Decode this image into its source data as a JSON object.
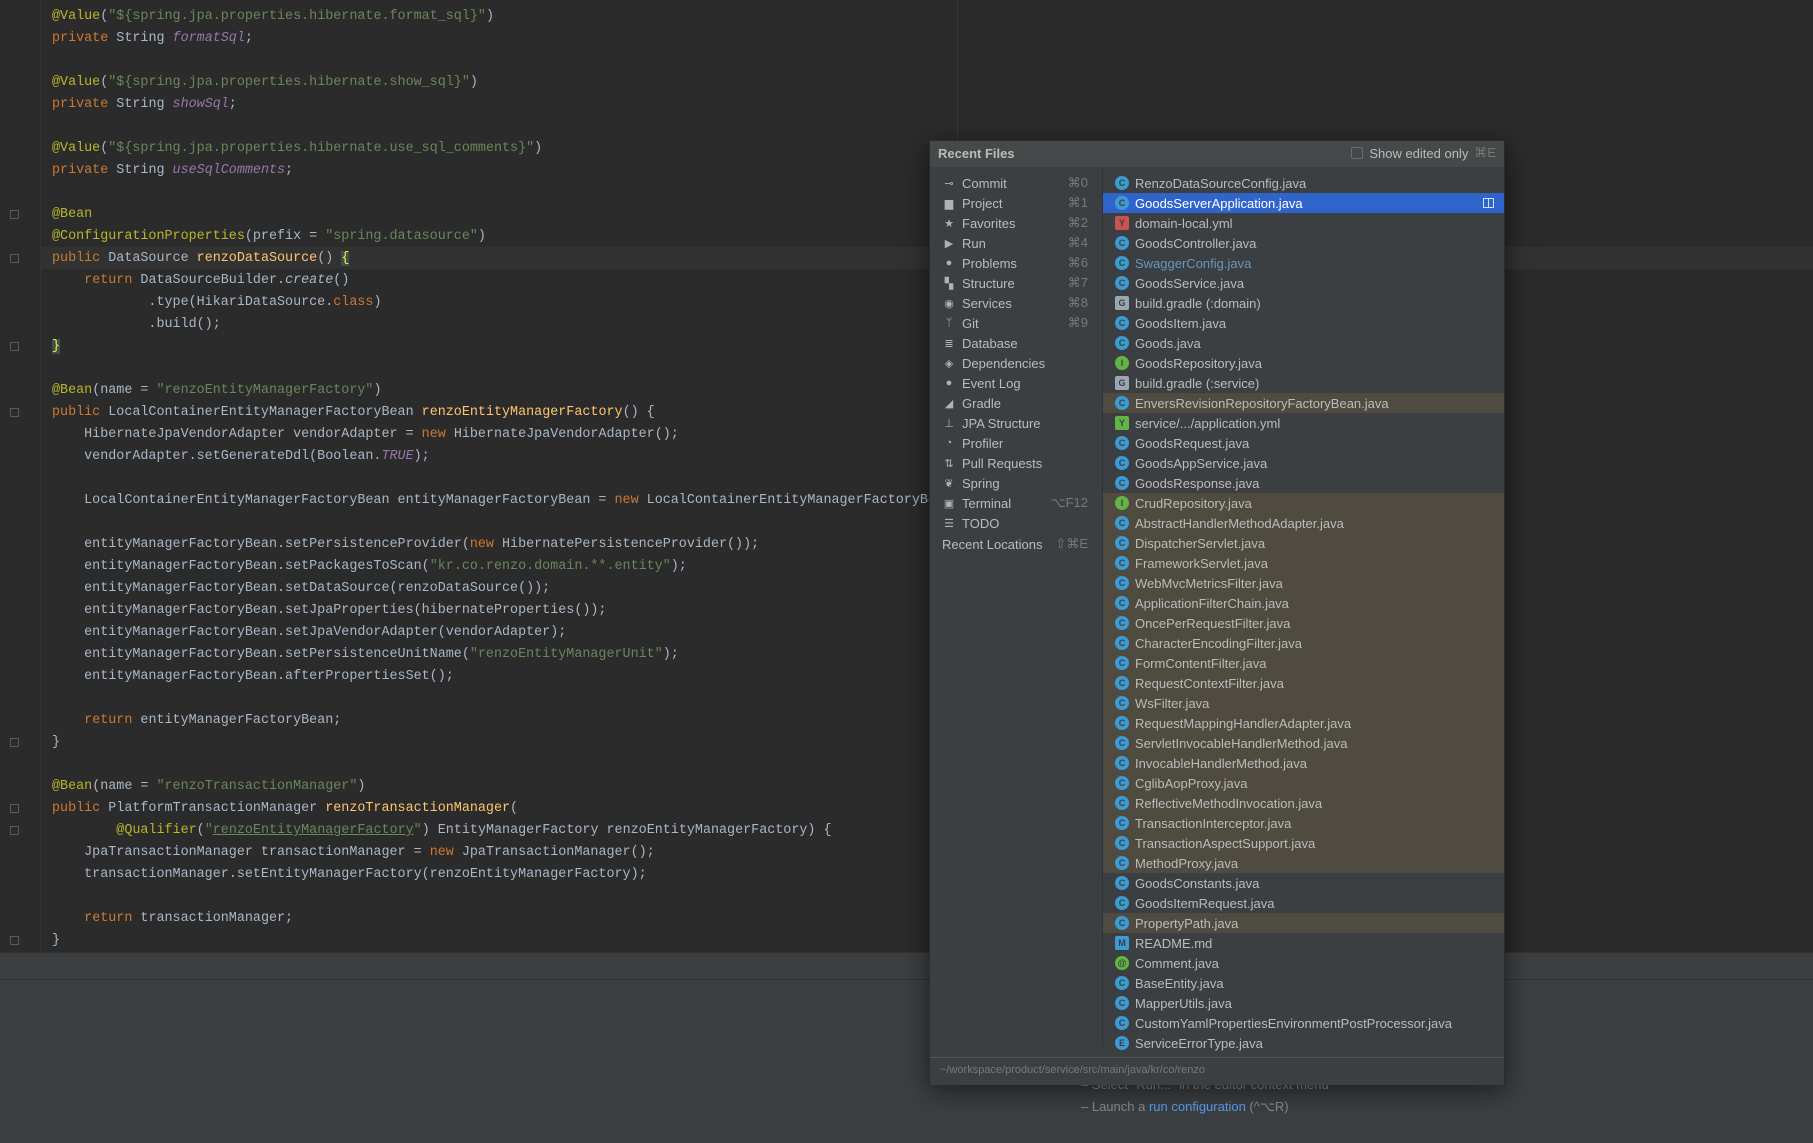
{
  "editor": {
    "lines": [
      [
        [
          "an",
          "@Value"
        ],
        [
          "",
          "("
        ],
        [
          "st",
          "\"${spring.jpa.properties.hibernate.format_sql}\""
        ],
        [
          "",
          ")"
        ]
      ],
      [
        [
          "kw",
          "private "
        ],
        [
          "",
          "String "
        ],
        [
          "cn",
          "formatSql"
        ],
        [
          "",
          ";"
        ]
      ],
      [],
      [
        [
          "an",
          "@Value"
        ],
        [
          "",
          "("
        ],
        [
          "st",
          "\"${spring.jpa.properties.hibernate.show_sql}\""
        ],
        [
          "",
          ")"
        ]
      ],
      [
        [
          "kw",
          "private "
        ],
        [
          "",
          "String "
        ],
        [
          "cn",
          "showSql"
        ],
        [
          "",
          ";"
        ]
      ],
      [],
      [
        [
          "an",
          "@Value"
        ],
        [
          "",
          "("
        ],
        [
          "st",
          "\"${spring.jpa.properties.hibernate.use_sql_comments}\""
        ],
        [
          "",
          ")"
        ]
      ],
      [
        [
          "kw",
          "private "
        ],
        [
          "",
          "String "
        ],
        [
          "cn",
          "useSqlComments"
        ],
        [
          "",
          ";"
        ]
      ],
      [],
      [
        [
          "an",
          "@Bean"
        ]
      ],
      [
        [
          "an",
          "@ConfigurationProperties"
        ],
        [
          "",
          "(prefix = "
        ],
        [
          "st",
          "\"spring.datasource\""
        ],
        [
          "",
          ")"
        ]
      ],
      [
        [
          "kw",
          "public "
        ],
        [
          "",
          "DataSource "
        ],
        [
          "fn",
          "renzoDataSource"
        ],
        [
          "",
          "() "
        ],
        [
          "brace",
          "{"
        ]
      ],
      [
        [
          "",
          "    "
        ],
        [
          "kw",
          "return "
        ],
        [
          "",
          "DataSourceBuilder."
        ],
        [
          "it",
          "create"
        ],
        [
          "",
          "()"
        ]
      ],
      [
        [
          "",
          "            .type(HikariDataSource."
        ],
        [
          "kw",
          "class"
        ],
        [
          "",
          ")"
        ]
      ],
      [
        [
          "",
          "            .build();"
        ]
      ],
      [
        [
          "brace",
          "}"
        ]
      ],
      [],
      [
        [
          "an",
          "@Bean"
        ],
        [
          "",
          "(name = "
        ],
        [
          "st",
          "\"renzoEntityManagerFactory\""
        ],
        [
          "",
          ")"
        ]
      ],
      [
        [
          "kw",
          "public "
        ],
        [
          "",
          "LocalContainerEntityManagerFactoryBean "
        ],
        [
          "fn",
          "renzoEntityManagerFactory"
        ],
        [
          "",
          "() {"
        ]
      ],
      [
        [
          "",
          "    HibernateJpaVendorAdapter vendorAdapter = "
        ],
        [
          "kw",
          "new "
        ],
        [
          "",
          "HibernateJpaVendorAdapter();"
        ]
      ],
      [
        [
          "",
          "    vendorAdapter.setGenerateDdl(Boolean."
        ],
        [
          "cn",
          "TRUE"
        ],
        [
          "",
          ");"
        ]
      ],
      [],
      [
        [
          "",
          "    LocalContainerEntityManagerFactoryBean entityManagerFactoryBean = "
        ],
        [
          "kw",
          "new "
        ],
        [
          "",
          "LocalContainerEntityManagerFactoryBean();"
        ]
      ],
      [],
      [
        [
          "",
          "    entityManagerFactoryBean.setPersistenceProvider("
        ],
        [
          "kw",
          "new "
        ],
        [
          "",
          "HibernatePersistenceProvider());"
        ]
      ],
      [
        [
          "",
          "    entityManagerFactoryBean.setPackagesToScan("
        ],
        [
          "st",
          "\"kr.co.renzo.domain.**.entity\""
        ],
        [
          "",
          ");"
        ]
      ],
      [
        [
          "",
          "    entityManagerFactoryBean.setDataSource(renzoDataSource());"
        ]
      ],
      [
        [
          "",
          "    entityManagerFactoryBean.setJpaProperties(hibernateProperties());"
        ]
      ],
      [
        [
          "",
          "    entityManagerFactoryBean.setJpaVendorAdapter(vendorAdapter);"
        ]
      ],
      [
        [
          "",
          "    entityManagerFactoryBean.setPersistenceUnitName("
        ],
        [
          "st",
          "\"renzoEntityManagerUnit\""
        ],
        [
          "",
          ");"
        ]
      ],
      [
        [
          "",
          "    entityManagerFactoryBean.afterPropertiesSet();"
        ]
      ],
      [],
      [
        [
          "",
          "    "
        ],
        [
          "kw",
          "return "
        ],
        [
          "",
          "entityManagerFactoryBean;"
        ]
      ],
      [
        [
          "",
          "}"
        ]
      ],
      [],
      [
        [
          "an",
          "@Bean"
        ],
        [
          "",
          "(name = "
        ],
        [
          "st",
          "\"renzoTransactionManager\""
        ],
        [
          "",
          ")"
        ]
      ],
      [
        [
          "kw",
          "public "
        ],
        [
          "",
          "PlatformTransactionManager "
        ],
        [
          "fn",
          "renzoTransactionManager"
        ],
        [
          "",
          "("
        ]
      ],
      [
        [
          "",
          "        "
        ],
        [
          "an",
          "@Qualifier"
        ],
        [
          "",
          "("
        ],
        [
          "st",
          "\""
        ],
        [
          "st ul",
          "renzoEntityManagerFactory"
        ],
        [
          "st",
          "\""
        ],
        [
          "",
          ") EntityManagerFactory renzoEntityManagerFactory) {"
        ]
      ],
      [
        [
          "",
          "    JpaTransactionManager transactionManager = "
        ],
        [
          "kw",
          "new "
        ],
        [
          "",
          "JpaTransactionManager();"
        ]
      ],
      [
        [
          "",
          "    transactionManager.setEntityManagerFactory(renzoEntityManagerFactory);"
        ]
      ],
      [],
      [
        [
          "",
          "    "
        ],
        [
          "kw",
          "return "
        ],
        [
          "",
          "transactionManager;"
        ]
      ],
      [
        [
          "",
          "}"
        ]
      ]
    ]
  },
  "hints": {
    "line1": "– Select \"Run...\" in the editor context menu",
    "line2_prefix": "– Launch a ",
    "line2_link": "run configuration",
    "line2_suffix": " (^⌥R)"
  },
  "popup": {
    "title": "Recent Files",
    "show_edited_label": "Show edited only",
    "show_edited_shortcut": "⌘E",
    "path": "~/workspace/product/service/src/main/java/kr/co/renzo",
    "tool_windows": [
      {
        "label": "Commit",
        "shortcut": "⌘0",
        "icon": "commit-icon",
        "glyph": "⊸"
      },
      {
        "label": "Project",
        "shortcut": "⌘1",
        "icon": "folder-icon",
        "glyph": "▆"
      },
      {
        "label": "Favorites",
        "shortcut": "⌘2",
        "icon": "star-icon",
        "glyph": "★"
      },
      {
        "label": "Run",
        "shortcut": "⌘4",
        "icon": "play-icon",
        "glyph": "▶"
      },
      {
        "label": "Problems",
        "shortcut": "⌘6",
        "icon": "warning-icon",
        "glyph": "●"
      },
      {
        "label": "Structure",
        "shortcut": "⌘7",
        "icon": "structure-icon",
        "glyph": "▚"
      },
      {
        "label": "Services",
        "shortcut": "⌘8",
        "icon": "services-icon",
        "glyph": "◉"
      },
      {
        "label": "Git",
        "shortcut": "⌘9",
        "icon": "git-branch-icon",
        "glyph": "ᛘ"
      },
      {
        "label": "Database",
        "shortcut": "",
        "icon": "database-icon",
        "glyph": "≣"
      },
      {
        "label": "Dependencies",
        "shortcut": "",
        "icon": "layers-icon",
        "glyph": "◈"
      },
      {
        "label": "Event Log",
        "shortcut": "",
        "icon": "event-log-icon",
        "glyph": "●"
      },
      {
        "label": "Gradle",
        "shortcut": "",
        "icon": "gradle-icon",
        "glyph": "◢"
      },
      {
        "label": "JPA Structure",
        "shortcut": "",
        "icon": "jpa-structure-icon",
        "glyph": "⊥"
      },
      {
        "label": "Profiler",
        "shortcut": "",
        "icon": "profiler-icon",
        "glyph": "◔"
      },
      {
        "label": "Pull Requests",
        "shortcut": "",
        "icon": "pull-request-icon",
        "glyph": "⇅"
      },
      {
        "label": "Spring",
        "shortcut": "",
        "icon": "spring-leaf-icon",
        "glyph": "❦"
      },
      {
        "label": "Terminal",
        "shortcut": "⌥F12",
        "icon": "terminal-icon",
        "glyph": "▣"
      },
      {
        "label": "TODO",
        "shortcut": "",
        "icon": "todo-list-icon",
        "glyph": "☰"
      }
    ],
    "recent_locations": {
      "label": "Recent Locations",
      "shortcut": "⇧⌘E"
    },
    "files": [
      {
        "name": "RenzoDataSourceConfig.java",
        "icon": "java-class-icon",
        "kind": "c",
        "lib": false
      },
      {
        "name": "GoodsServerApplication.java",
        "icon": "spring-boot-class-icon",
        "kind": "c",
        "lib": false,
        "selected": true
      },
      {
        "name": "domain-local.yml",
        "icon": "yaml-file-icon",
        "kind": "yml",
        "lib": false
      },
      {
        "name": "GoodsController.java",
        "icon": "java-class-icon",
        "kind": "c",
        "lib": false
      },
      {
        "name": "SwaggerConfig.java",
        "icon": "java-class-icon",
        "kind": "c",
        "lib": false,
        "modified": true
      },
      {
        "name": "GoodsService.java",
        "icon": "java-class-icon",
        "kind": "c",
        "lib": false
      },
      {
        "name": "build.gradle (:domain)",
        "icon": "gradle-file-icon",
        "kind": "gradle",
        "lib": false
      },
      {
        "name": "GoodsItem.java",
        "icon": "java-class-icon",
        "kind": "c",
        "lib": false
      },
      {
        "name": "Goods.java",
        "icon": "java-class-icon",
        "kind": "c",
        "lib": false
      },
      {
        "name": "GoodsRepository.java",
        "icon": "java-interface-icon",
        "kind": "i",
        "lib": false
      },
      {
        "name": "build.gradle (:service)",
        "icon": "gradle-file-icon",
        "kind": "gradle",
        "lib": false
      },
      {
        "name": "EnversRevisionRepositoryFactoryBean.java",
        "icon": "java-class-icon",
        "kind": "c",
        "lib": true
      },
      {
        "name": "service/.../application.yml",
        "icon": "spring-yaml-icon",
        "kind": "yml2",
        "lib": false
      },
      {
        "name": "GoodsRequest.java",
        "icon": "java-class-icon",
        "kind": "c",
        "lib": false
      },
      {
        "name": "GoodsAppService.java",
        "icon": "java-class-icon",
        "kind": "c",
        "lib": false
      },
      {
        "name": "GoodsResponse.java",
        "icon": "java-class-icon",
        "kind": "c",
        "lib": false
      },
      {
        "name": "CrudRepository.java",
        "icon": "java-interface-icon",
        "kind": "i",
        "lib": true
      },
      {
        "name": "AbstractHandlerMethodAdapter.java",
        "icon": "java-abstract-class-icon",
        "kind": "a",
        "lib": true
      },
      {
        "name": "DispatcherServlet.java",
        "icon": "java-class-icon",
        "kind": "c",
        "lib": true
      },
      {
        "name": "FrameworkServlet.java",
        "icon": "java-abstract-class-icon",
        "kind": "a",
        "lib": true
      },
      {
        "name": "WebMvcMetricsFilter.java",
        "icon": "java-class-icon",
        "kind": "c",
        "lib": true
      },
      {
        "name": "ApplicationFilterChain.java",
        "icon": "java-class-icon",
        "kind": "c",
        "lib": true
      },
      {
        "name": "OncePerRequestFilter.java",
        "icon": "java-abstract-class-icon",
        "kind": "a",
        "lib": true
      },
      {
        "name": "CharacterEncodingFilter.java",
        "icon": "java-class-icon",
        "kind": "c",
        "lib": true
      },
      {
        "name": "FormContentFilter.java",
        "icon": "java-class-icon",
        "kind": "c",
        "lib": true
      },
      {
        "name": "RequestContextFilter.java",
        "icon": "java-class-icon",
        "kind": "c",
        "lib": true
      },
      {
        "name": "WsFilter.java",
        "icon": "java-class-icon",
        "kind": "c",
        "lib": true
      },
      {
        "name": "RequestMappingHandlerAdapter.java",
        "icon": "java-class-icon",
        "kind": "c",
        "lib": true
      },
      {
        "name": "ServletInvocableHandlerMethod.java",
        "icon": "java-class-icon",
        "kind": "c",
        "lib": true
      },
      {
        "name": "InvocableHandlerMethod.java",
        "icon": "java-class-icon",
        "kind": "c",
        "lib": true
      },
      {
        "name": "CglibAopProxy.java",
        "icon": "java-class-icon",
        "kind": "c",
        "lib": true
      },
      {
        "name": "ReflectiveMethodInvocation.java",
        "icon": "java-class-icon",
        "kind": "c",
        "lib": true
      },
      {
        "name": "TransactionInterceptor.java",
        "icon": "java-class-icon",
        "kind": "c",
        "lib": true
      },
      {
        "name": "TransactionAspectSupport.java",
        "icon": "java-abstract-class-icon",
        "kind": "a",
        "lib": true
      },
      {
        "name": "MethodProxy.java",
        "icon": "java-class-icon",
        "kind": "c",
        "lib": true
      },
      {
        "name": "GoodsConstants.java",
        "icon": "java-class-icon",
        "kind": "c",
        "lib": false
      },
      {
        "name": "GoodsItemRequest.java",
        "icon": "java-class-icon",
        "kind": "c",
        "lib": false
      },
      {
        "name": "PropertyPath.java",
        "icon": "java-class-icon",
        "kind": "c",
        "lib": true
      },
      {
        "name": "README.md",
        "icon": "markdown-file-icon",
        "kind": "md",
        "lib": false
      },
      {
        "name": "Comment.java",
        "icon": "annotation-icon",
        "kind": "at",
        "lib": false
      },
      {
        "name": "BaseEntity.java",
        "icon": "java-class-icon",
        "kind": "c",
        "lib": false
      },
      {
        "name": "MapperUtils.java",
        "icon": "java-class-icon",
        "kind": "c",
        "lib": false
      },
      {
        "name": "CustomYamlPropertiesEnvironmentPostProcessor.java",
        "icon": "java-class-icon",
        "kind": "c",
        "lib": false
      },
      {
        "name": "ServiceErrorType.java",
        "icon": "java-enum-icon",
        "kind": "e",
        "lib": false
      }
    ]
  },
  "colors": {
    "selection": "#2f65ca",
    "library_row": "#4f4b41",
    "class_icon": "#3d9bd3",
    "interface_icon": "#62b543",
    "modified_file": "#6897bb"
  }
}
